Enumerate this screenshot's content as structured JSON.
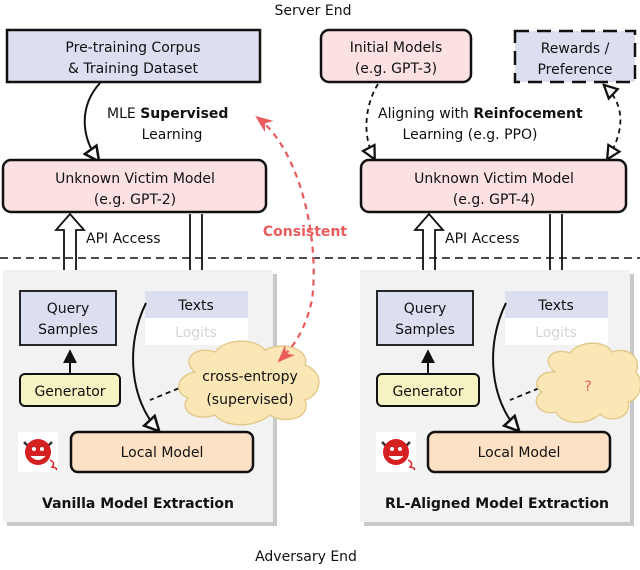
{
  "colors": {
    "blue_box": "#dcdff0",
    "pink_box": "#fbe1e2",
    "yellow_box": "#f5f3c2",
    "orange_box": "#fde1c4",
    "cloud": "#fbe7b5",
    "panel": "#f2f2f2",
    "panel_shadow": "#c9c9c9",
    "consistent_red": "#ea5b5b",
    "logits_gray": "#d4d4d4"
  },
  "labels": {
    "server_end": "Server End",
    "adversary_end": "Adversary End",
    "consistent": "Consistent"
  },
  "left": {
    "corpus_line1": "Pre-training Corpus",
    "corpus_line2": "& Training Dataset",
    "training_line1_prefix": "MLE ",
    "training_line1_bold": "Supervised",
    "training_line2": "Learning",
    "victim_line1": "Unknown Victim Model",
    "victim_line2": "(e.g. GPT-2)",
    "api_access": "API Access",
    "query_line1": "Query",
    "query_line2": "Samples",
    "texts": "Texts",
    "logits": "Logits",
    "generator": "Generator",
    "cloud_line1": "cross-entropy",
    "cloud_line2": "(supervised)",
    "local_model": "Local Model",
    "panel_title": "Vanilla Model Extraction",
    "attacker_icon": "devil-icon"
  },
  "right": {
    "initial_line1": "Initial Models",
    "initial_line2": "(e.g. GPT-3)",
    "rewards_line1": "Rewards /",
    "rewards_line2": "Preference",
    "training_line1_prefix": "Aligning with ",
    "training_line1_bold": "Reinfocement",
    "training_line2": "Learning (e.g. PPO)",
    "victim_line1": "Unknown Victim Model",
    "victim_line2": "(e.g. GPT-4)",
    "api_access": "API Access",
    "query_line1": "Query",
    "query_line2": "Samples",
    "texts": "Texts",
    "logits": "Logits",
    "generator": "Generator",
    "cloud_text": "?",
    "local_model": "Local Model",
    "panel_title": "RL-Aligned Model Extraction",
    "attacker_icon": "devil-icon"
  }
}
